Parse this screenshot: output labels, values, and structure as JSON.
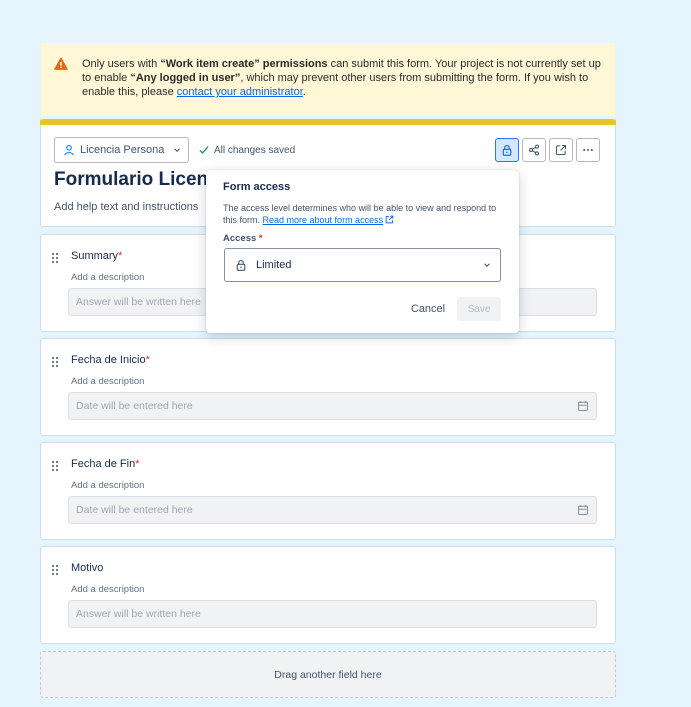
{
  "banner": {
    "text_1": "Only users with ",
    "bold_1": "“Work item create” permissions",
    "text_2": " can submit this form. Your project is not currently set up to enable ",
    "bold_2": "“Any logged in user”",
    "text_3": ", which may prevent other users from submitting the form. If you wish to enable this, please ",
    "link": "contact your administrator",
    "text_4": ".",
    "accent": "#fff7d6"
  },
  "header": {
    "project_label": "Licencia Persona",
    "saved_text": "All changes saved",
    "form_title": "Formulario Licenc",
    "help_text": "Add help text and instructions",
    "bar_color": "#e2c62a",
    "actions": [
      "lock-icon",
      "share-icon",
      "open-external-icon",
      "more-icon"
    ]
  },
  "fields": [
    {
      "label": "Summary",
      "required": "*",
      "description": "Add a description",
      "placeholder": "Answer will be written here"
    },
    {
      "label": "Fecha de Inicio",
      "required": "*",
      "description": "Add a description",
      "placeholder": "Date will be entered here"
    },
    {
      "label": "Fecha de Fin",
      "required": "*",
      "description": "Add a description",
      "placeholder": "Date will be entered here"
    },
    {
      "label": "Motivo",
      "required": "",
      "description": "Add a description",
      "placeholder": "Answer will be written here"
    }
  ],
  "drop_zone": "Drag another field here",
  "popover": {
    "title": "Form access",
    "description": "The access level determines who will be able to view and respond to this form. ",
    "link": "Read more about form access",
    "access_label": "Access",
    "required": "*",
    "access_value": "Limited",
    "cancel": "Cancel",
    "save": "Save"
  }
}
